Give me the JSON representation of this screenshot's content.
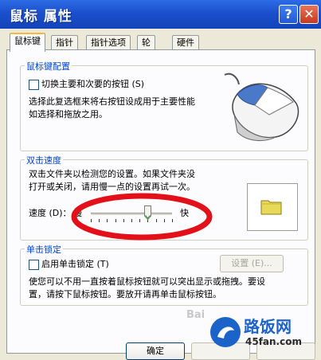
{
  "window": {
    "title": "鼠标 属性",
    "help_label": "?",
    "close_label": "✕"
  },
  "tabs": [
    {
      "label": "鼠标键"
    },
    {
      "label": "指针"
    },
    {
      "label": "指针选项"
    },
    {
      "label": "轮"
    },
    {
      "label": "硬件"
    }
  ],
  "button_config": {
    "legend": "鼠标键配置",
    "swap_label": "切换主要和次要的按钮",
    "swap_shortcut": "(S)",
    "swap_checked": false,
    "desc_line1": "选择此复选框来将右按钮设成用于主要性能",
    "desc_line2": "如选择和拖放之用。"
  },
  "double_click": {
    "legend": "双击速度",
    "desc_line1": "双击文件夹以检测您的设置。如果文件夹没",
    "desc_line2": "打开或关闭，请用慢一点的设置再试一次。",
    "speed_label": "速度 (D)：",
    "slow_label": "慢",
    "fast_label": "快",
    "speed_value": 0.7
  },
  "click_lock": {
    "legend": "单击锁定",
    "enable_label": "启用单击锁定 (T)",
    "enable_checked": false,
    "settings_label": "设置 (E)...",
    "desc_line1": "使您可以不用一直按着鼠标按钮就可以突出显示或拖拽。要设",
    "desc_line2": "置，请按下鼠标按钮。要放开请再单击鼠标按钮。"
  },
  "footer": {
    "ok_label": "确定"
  },
  "watermark": {
    "brand": "路饭网",
    "site": "45fan.com",
    "baidu": "Bai"
  },
  "colors": {
    "annotation_ring": "#E3101A",
    "folder": "#E8D95A",
    "mouse_button": "#4A79C9"
  }
}
